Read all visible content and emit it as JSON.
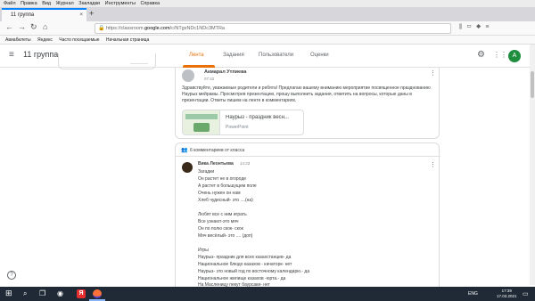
{
  "browser": {
    "menu": [
      "Файл",
      "Правка",
      "Вид",
      "Журнал",
      "Закладки",
      "Инструменты",
      "Справка"
    ],
    "tab_title": "11 группа",
    "tab_close": "×",
    "new_tab": "+",
    "url_prefix": "https://classroom.",
    "url_domain": "google.com",
    "url_rest": "/c/NTgxNDc1NDc3MTRa",
    "bookmarks": [
      "Авиабилеты",
      "Яндекс",
      "Часто посещаемые",
      "Начальная страница"
    ]
  },
  "classroom": {
    "title": "11 группа",
    "tabs": [
      "Лента",
      "Задания",
      "Пользователи",
      "Оценки"
    ],
    "active_tab": "Лента",
    "user_initial": "A"
  },
  "post": {
    "author": "Акмарал Утпиева",
    "time": "07:42",
    "text": "Здравствуйте, уважаемые родители и ребята! Предлагаю вашему вниманию мероприятие посвященное празднованию Наурыз мейрамы. Просмотрев презентацию, прошу выполнить задания, ответить на вопросы, которые даны в презентации. Ответы пишем на ленте в комментариях.",
    "attachment_title": "Наурыз - праздник весн...",
    "attachment_type": "PowerPoint"
  },
  "comments": {
    "count_label": "6 комментариев от класса",
    "author": "Вика Леонтьева",
    "time": "14:23",
    "lines": [
      "Загадки",
      "Он растет не в огороде",
      "А растет в большущем поле",
      "Очень нужен он нам",
      "Хлеб чудесный- это ....(на)",
      "",
      "Любят все с ним играть",
      "Все узнают-это мяч",
      "Он по полю скок- скок",
      "Мяч весёлый- это .... (доп)",
      "",
      "Игры",
      "Наурыз- праздник для всех казахстанцев- да",
      "Национальное блюдо казахов - качаторк- нет",
      "Наурыз- это новый год по восточному календарю.- да",
      "Национальное жилище казахов -юрта.- да",
      "На Масленицу пекут баурсаки- нет"
    ]
  },
  "taskbar": {
    "lang": "ENG",
    "time": "17:39",
    "date": "17.03.2021"
  },
  "colors": {
    "accent": "#e8710a",
    "avatar_green": "#1e8e3e",
    "taskbar": "#1f2a36"
  }
}
